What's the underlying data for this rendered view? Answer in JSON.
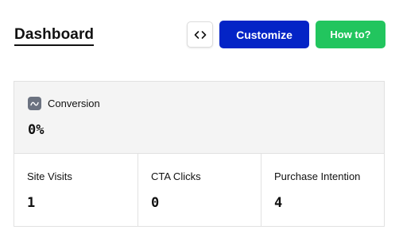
{
  "header": {
    "title": "Dashboard",
    "code_button_icon": "code-brackets-icon",
    "customize_label": "Customize",
    "howto_label": "How to?"
  },
  "colors": {
    "customize_bg": "#0424c6",
    "howto_bg": "#22c55e",
    "card_bg": "#f4f4f4"
  },
  "conversion": {
    "icon": "trend-wave-icon",
    "label": "Conversion",
    "value": "0%"
  },
  "stats": [
    {
      "label": "Site Visits",
      "value": "1"
    },
    {
      "label": "CTA Clicks",
      "value": "0"
    },
    {
      "label": "Purchase Intention",
      "value": "4"
    }
  ]
}
